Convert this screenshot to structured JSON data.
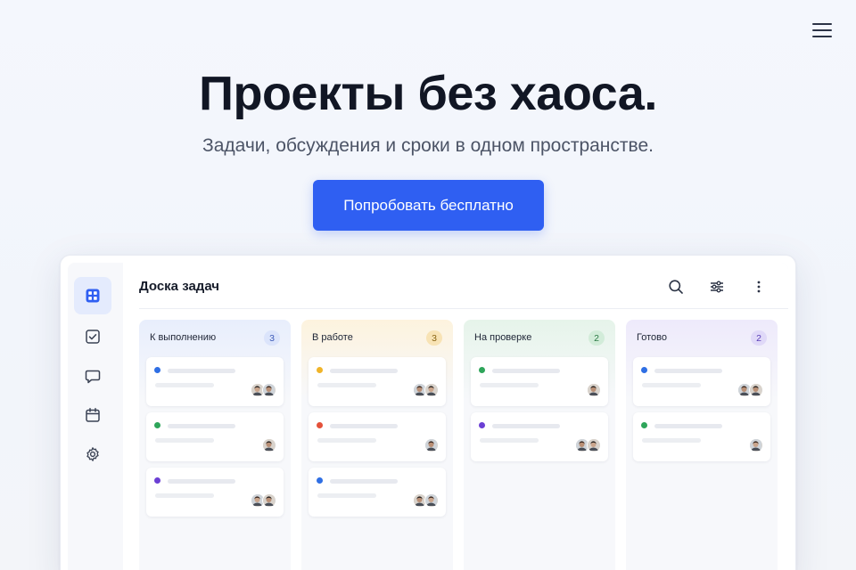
{
  "hero": {
    "title": "Проекты без хаоса.",
    "subtitle": "Задачи, обсуждения и сроки в одном пространстве.",
    "cta_label": "Попробовать бесплатно"
  },
  "nav": {
    "menu_icon": "hamburger-menu-icon"
  },
  "app": {
    "board_title": "Доска задач",
    "sidebar": [
      "grid-icon",
      "checkbox-icon",
      "chat-icon",
      "calendar-icon",
      "settings-icon"
    ],
    "toolbar": [
      "search-icon",
      "filter-sliders-icon",
      "more-vertical-icon"
    ],
    "columns": [
      {
        "name": "К выполнению",
        "count": "3",
        "tint": "#e8eefc",
        "count_bg": "#dbe4fb",
        "count_color": "#3d5bb8",
        "cards": [
          {
            "dot": "#2f6fe4",
            "avatars": 2
          },
          {
            "dot": "#2ea55a",
            "avatars": 1
          },
          {
            "dot": "#6b3fd4",
            "avatars": 2
          }
        ]
      },
      {
        "name": "В работе",
        "count": "3",
        "tint": "#fdf3de",
        "count_bg": "#f8e3b5",
        "count_color": "#8a6414",
        "cards": [
          {
            "dot": "#f0b429",
            "avatars": 2
          },
          {
            "dot": "#e4513a",
            "avatars": 1
          },
          {
            "dot": "#2f6fe4",
            "avatars": 2
          }
        ]
      },
      {
        "name": "На проверке",
        "count": "2",
        "tint": "#e6f4ea",
        "count_bg": "#d2ecd9",
        "count_color": "#2c7a45",
        "cards": [
          {
            "dot": "#2ea55a",
            "avatars": 1
          },
          {
            "dot": "#6b3fd4",
            "avatars": 2
          }
        ]
      },
      {
        "name": "Готово",
        "count": "2",
        "tint": "#eeeafb",
        "count_bg": "#e0d9f8",
        "count_color": "#5a3fb8",
        "cards": [
          {
            "dot": "#2f6fe4",
            "avatars": 2
          },
          {
            "dot": "#2ea55a",
            "avatars": 1
          }
        ]
      }
    ]
  },
  "colors": {
    "accent": "#2f5ff2",
    "title": "#111624",
    "subtitle": "#4c5466"
  }
}
